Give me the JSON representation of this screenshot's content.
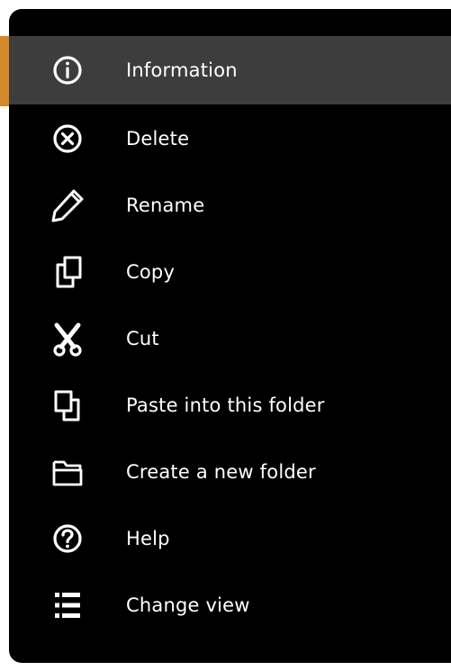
{
  "colors": {
    "menu_background": "#000000",
    "highlight_background": "#3d3d3d",
    "accent": "#d6892a",
    "text": "#ffffff"
  },
  "menu": {
    "items": [
      {
        "label": "Information",
        "icon": "info-icon",
        "highlighted": true
      },
      {
        "label": "Delete",
        "icon": "delete-icon"
      },
      {
        "label": "Rename",
        "icon": "pencil-icon"
      },
      {
        "label": "Copy",
        "icon": "copy-icon"
      },
      {
        "label": "Cut",
        "icon": "scissors-icon"
      },
      {
        "label": "Paste into this folder",
        "icon": "paste-icon"
      },
      {
        "label": "Create a new folder",
        "icon": "folder-icon"
      },
      {
        "label": "Help",
        "icon": "help-icon"
      },
      {
        "label": "Change view",
        "icon": "list-view-icon"
      }
    ]
  }
}
